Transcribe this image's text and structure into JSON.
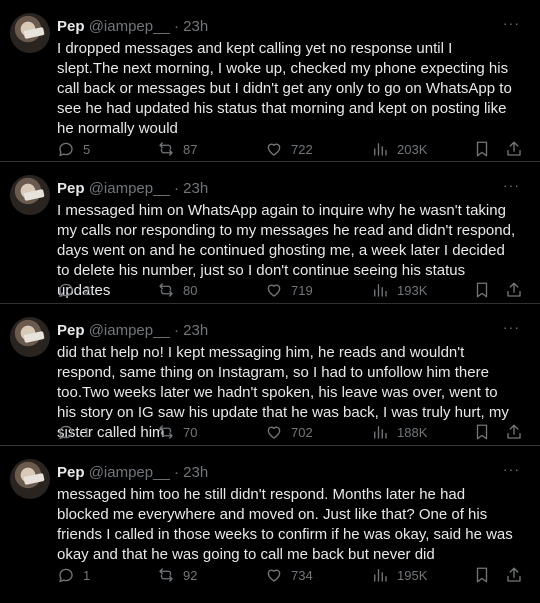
{
  "tweets": [
    {
      "name": "Pep",
      "handle": "@iampep__",
      "separator": "·",
      "time": "23h",
      "more": "···",
      "text": "I dropped messages and kept calling yet no response until I slept.The next morning, I woke up, checked my phone expecting his call back or messages but I didn't get any only to go on WhatsApp to see he had updated his status that morning and kept on posting like he normally would",
      "replies": "5",
      "reposts": "87",
      "likes": "722",
      "views": "203K"
    },
    {
      "name": "Pep",
      "handle": "@iampep__",
      "separator": "·",
      "time": "23h",
      "more": "···",
      "text": "I messaged him on WhatsApp again to inquire why he wasn't taking my calls nor responding to my messages he read and didn't respond, days went on and he continued ghosting me, a week later I decided to delete his number, just so I don't continue seeing his status updates",
      "replies": "2",
      "reposts": "80",
      "likes": "719",
      "views": "193K"
    },
    {
      "name": "Pep",
      "handle": "@iampep__",
      "separator": "·",
      "time": "23h",
      "more": "···",
      "text": "did that help no! I kept messaging him, he reads and wouldn't respond, same thing on Instagram, so I had to unfollow him there too.Two weeks later we hadn't spoken, his leave was over, went to his story on IG saw his update that he was back, I was truly hurt, my sister called him",
      "replies": "1",
      "reposts": "70",
      "likes": "702",
      "views": "188K"
    },
    {
      "name": "Pep",
      "handle": "@iampep__",
      "separator": "·",
      "time": "23h",
      "more": "···",
      "text": "messaged him too he still didn't respond. Months later he had blocked me everywhere and moved on. Just like that?  One of his friends I called in those weeks to confirm if he was okay, said he was okay and that he was going to call me back but never did",
      "replies": "1",
      "reposts": "92",
      "likes": "734",
      "views": "195K"
    }
  ]
}
